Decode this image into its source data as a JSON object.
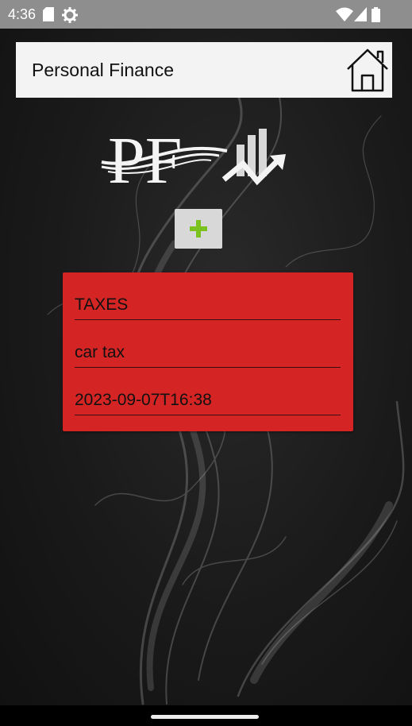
{
  "status_bar": {
    "time": "4:36",
    "icons": [
      "sd-card-icon",
      "settings-gear-icon",
      "wifi-icon",
      "signal-icon",
      "battery-icon"
    ]
  },
  "app_bar": {
    "title": "Personal Finance",
    "home_icon": "home-icon"
  },
  "logo": {
    "text": "PF"
  },
  "add_button": {
    "icon": "plus-icon",
    "color": "#7bc21f"
  },
  "entry_card": {
    "background": "#d42424",
    "category": "TAXES",
    "description": "car tax",
    "datetime": "2023-09-07T16:38"
  },
  "colors": {
    "status_bar": "#8e8e8e",
    "app_bar": "#f3f3f3",
    "background": "#141414"
  }
}
